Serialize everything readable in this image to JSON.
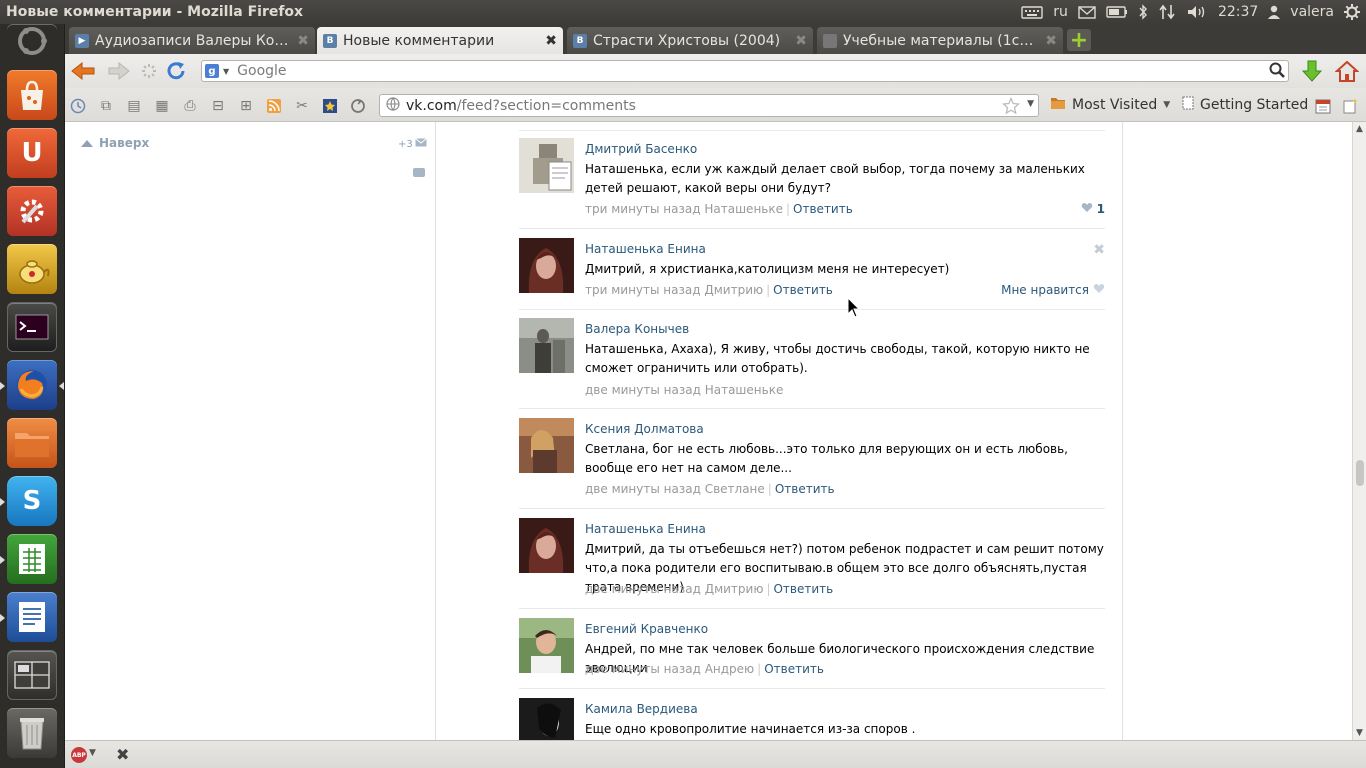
{
  "window": {
    "title": "Новые комментарии - Mozilla Firefox"
  },
  "system": {
    "keyboard_layout": "ru",
    "clock": "22:37",
    "user": "valera"
  },
  "launcher": {
    "items": [
      {
        "name": "ubuntu-dash",
        "color": "#3a3a38"
      },
      {
        "name": "software-center",
        "color": "#d8641e"
      },
      {
        "name": "ubuntu-one",
        "color": "#d9531e"
      },
      {
        "name": "system-settings",
        "color": "#c23b2a"
      },
      {
        "name": "teapot-app",
        "color": "#c99a1a"
      },
      {
        "name": "terminal",
        "color": "#2b2b2b"
      },
      {
        "name": "firefox",
        "color": "#c8561b"
      },
      {
        "name": "files",
        "color": "#d0571e"
      },
      {
        "name": "skype",
        "color": "#1a8fd4"
      },
      {
        "name": "libreoffice-calc",
        "color": "#2f8a28"
      },
      {
        "name": "libreoffice-writer",
        "color": "#275ea8"
      },
      {
        "name": "workspace-switcher",
        "color": "#3b3a37"
      },
      {
        "name": "trash",
        "color": "#3b3a37"
      }
    ]
  },
  "tabs": [
    {
      "label": "Аудиозаписи Валеры Кон…",
      "favicon": "audio",
      "active": false
    },
    {
      "label": "Новые комментарии",
      "favicon": "vk",
      "active": true
    },
    {
      "label": "Страсти Христовы (2004)",
      "favicon": "vk",
      "active": false
    },
    {
      "label": "Учебные материалы (1се…",
      "favicon": "page",
      "active": false
    }
  ],
  "search": {
    "engine": "Google",
    "placeholder": "Google"
  },
  "url": {
    "host": "vk.com",
    "path": "/feed?section=comments"
  },
  "bookmarks": {
    "most_visited": "Most Visited",
    "getting_started": "Getting Started"
  },
  "sidebar": {
    "naverh": "Наверх",
    "notif_count": "+3"
  },
  "comments": [
    {
      "author": "Дмитрий Басенко",
      "text": "Наташенька, если уж каждый делает свой выбор, тогда почему за маленьких детей решают, какой веры они будут?",
      "time": "три минуты назад",
      "recipient": "Наташеньке",
      "reply": "Ответить",
      "likes": "1",
      "avatar_color": "#8a8578"
    },
    {
      "author": "Наташенька Енина",
      "text": "Дмитрий, я христианка,католицизм меня не интересует)",
      "time": "три минуты назад",
      "recipient": "Дмитрию",
      "reply": "Ответить",
      "like_label": "Мне нравится",
      "avatar_color": "#5a2a24"
    },
    {
      "author": "Валера Конычев",
      "text": "Наташенька, Ахаха), Я живу, чтобы достичь свободы, такой, которую никто не сможет ограничить или отобрать).",
      "time": "две минуты назад",
      "recipient": "Наташеньке",
      "avatar_color": "#545a4e"
    },
    {
      "author": "Ксения Долматова",
      "text": "Светлана, бог не есть любовь...это только для верующих он и есть любовь, вообще его нет на самом деле...",
      "time": "две минуты назад",
      "recipient": "Светлане",
      "reply": "Ответить",
      "avatar_color": "#7a4a3a"
    },
    {
      "author": "Наташенька Енина",
      "text": "Дмитрий, да ты отъебешься нет?) потом ребенок подрастет и сам решит потому что,а пока родители его воспитываю.в общем это все долго объяснять,пустая трата времени)",
      "time": "две минуты назад",
      "recipient": "Дмитрию",
      "reply": "Ответить",
      "avatar_color": "#5a2a24"
    },
    {
      "author": "Евгений Кравченко",
      "text": "Андрей, по мне так человек больше биологического происхождения следствие эволюции",
      "time": "две минуты назад",
      "recipient": "Андрею",
      "reply": "Ответить",
      "avatar_color": "#4f6e3e"
    },
    {
      "author": "Камила Вердиева",
      "text": "Еще одно кровопролитие начинается из-за споров .",
      "avatar_color": "#2d2d2d"
    }
  ]
}
